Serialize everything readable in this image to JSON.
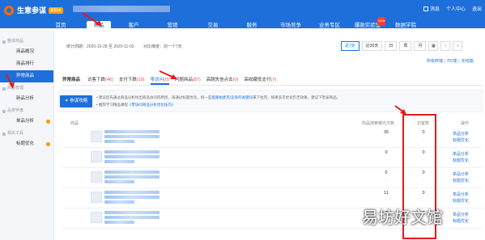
{
  "header": {
    "app_name": "生意参谋",
    "badge": "新版本",
    "right_links": [
      "消息",
      "个人中心",
      "退出"
    ],
    "nav": [
      {
        "label": "首页"
      },
      {
        "label": "商品",
        "active": true
      },
      {
        "label": "客户"
      },
      {
        "label": "营销"
      },
      {
        "label": "交易"
      },
      {
        "label": "服务"
      },
      {
        "label": "市场竞争"
      },
      {
        "label": "业务专区"
      },
      {
        "label": "爆款实验室",
        "badge": "NEW"
      },
      {
        "label": "数据学院"
      }
    ]
  },
  "sidebar": {
    "groups": [
      {
        "title": "整体商品",
        "items": [
          {
            "label": "商品概况"
          },
          {
            "label": "商品排行"
          },
          {
            "label": "异常商品",
            "active": true
          }
        ]
      },
      {
        "title": "商品管理",
        "items": [
          {
            "label": "新品分析"
          }
        ]
      },
      {
        "title": "品类罗盘",
        "items": [
          {
            "label": "单品分析",
            "dot": true
          }
        ]
      },
      {
        "title": "相关工具",
        "items": [
          {
            "label": "标题优化",
            "dot": true
          }
        ]
      }
    ]
  },
  "stats": {
    "period": "统计周期：2020-10-28 至 2020-11-03",
    "dimension": "对比维度：前一个7天"
  },
  "range_tabs": [
    "近7天",
    "近30天",
    "日",
    "周",
    "月",
    "calendar-icon",
    "chevron-left-icon",
    "chevron-right-icon"
  ],
  "channel": {
    "all": "所有终端",
    "pc": "PC端",
    "wireless": "无线端"
  },
  "subtabs": [
    {
      "label": "异常商品",
      "first": true
    },
    {
      "label": "访客下跌",
      "count": "(46)"
    },
    {
      "label": "支付下跌",
      "count": "(19)"
    },
    {
      "label": "零访问",
      "count": "(0)",
      "active": true
    },
    {
      "label": "问题商品",
      "count": "(87)"
    },
    {
      "label": "高跳失信点击",
      "count": "(0)"
    },
    {
      "label": "高收藏低支付",
      "count": "(7)"
    }
  ],
  "tip": {
    "button": "参谋攻略",
    "line1_prefix": "建议您先通过商品分析找出商品访问的原因，再通过标题优化，找一些",
    "line1_link": "能跟拍麦克/竞争的关键词",
    "line1_suffix": "来下拉完，如果多次优化仍无效果，建议下架该商品。",
    "line2_prefix": "推荐学习精品课程",
    "line2_link": "《零访问商品分析优化技巧》"
  },
  "table": {
    "headers": [
      "商品",
      "商品搜索曝光次数",
      "访客数",
      "操作"
    ],
    "rows": [
      {
        "v1": "35",
        "v1_sub": "-",
        "v2": "0",
        "v2_sub": "-",
        "ops": [
          "单品分析",
          "标题优化"
        ]
      },
      {
        "v1": "0",
        "v1_sub": "-",
        "v2": "0",
        "v2_sub": "-",
        "ops": [
          "单品分析",
          "标题优化"
        ]
      },
      {
        "v1": "0",
        "v1_sub": "-",
        "v2": "0",
        "v2_sub": "-",
        "ops": [
          "单品分析",
          "标题优化"
        ]
      },
      {
        "v1": "11",
        "v1_sub": "-",
        "v2": "0",
        "v2_sub": "-",
        "ops": [
          "单品分析",
          "标题优化"
        ]
      },
      {
        "v1": "0",
        "v1_sub": "-",
        "v2": "0",
        "v2_sub": "-",
        "ops": [
          "单品分析",
          "标题优化"
        ]
      }
    ]
  },
  "watermark": "易坊好文馆",
  "annotation_color": "#e21b1b"
}
